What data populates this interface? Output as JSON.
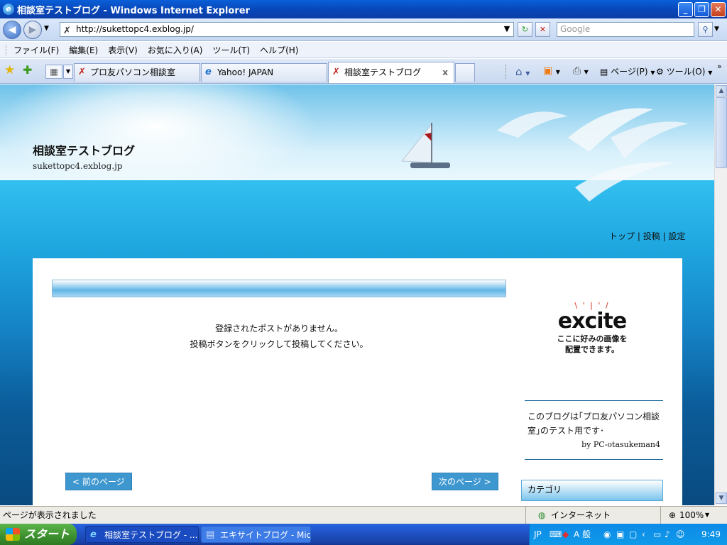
{
  "window": {
    "title": "相談室テストブログ - Windows Internet Explorer",
    "min": "_",
    "max": "❐",
    "close": "✕"
  },
  "address": {
    "url": "http://sukettopc4.exblog.jp/",
    "search_placeholder": "Google"
  },
  "menu": [
    "ファイル(F)",
    "編集(E)",
    "表示(V)",
    "お気に入り(A)",
    "ツール(T)",
    "ヘルプ(H)"
  ],
  "tabs": [
    {
      "label": "プロ友パソコン相談室"
    },
    {
      "label": "Yahoo! JAPAN"
    },
    {
      "label": "相談室テストブログ"
    }
  ],
  "cmdbar": {
    "page": "ページ(P)",
    "tools": "ツール(O)"
  },
  "blog": {
    "title": "相談室テストブログ",
    "url": "sukettopc4.exblog.jp",
    "toplinks": {
      "top": "トップ",
      "sep": " | ",
      "post": "投稿",
      "settings": "設定"
    },
    "no_post_line1": "登録されたポストがありません。",
    "no_post_line2": "投稿ボタンをクリックして投稿してください。",
    "prev": "< 前のページ",
    "next": "次のページ >",
    "excite_logo": "excite",
    "excite_caption1": "ここに好みの画像を",
    "excite_caption2": "配置できます。",
    "about_text": "このブログは｢プロ友パソコン相談室｣のテスト用です･",
    "about_by": "by PC-otasukeman4",
    "category": "カテゴリ"
  },
  "status": {
    "text": "ページが表示されました",
    "zone": "インターネット",
    "zoom": "100%"
  },
  "taskbar": {
    "start": "スタート",
    "items": [
      {
        "label": "相談室テストブログ - ..."
      },
      {
        "label": "エキサイトブログ - Micr..."
      }
    ],
    "lang": "JP",
    "ime": "A 般",
    "clock": "9:49"
  }
}
